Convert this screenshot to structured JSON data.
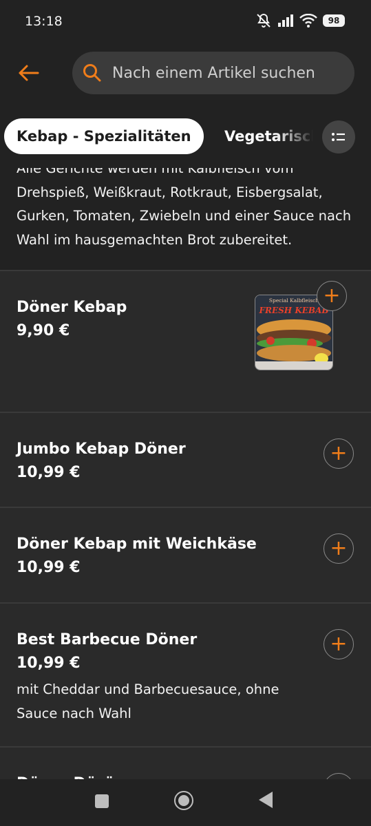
{
  "status_bar": {
    "time": "13:18",
    "battery": "98"
  },
  "search": {
    "placeholder": "Nach einem Artikel suchen"
  },
  "tabs": [
    {
      "label": "Kebap - Spezialitäten",
      "active": true
    },
    {
      "label": "Vegetarisch",
      "active": false
    }
  ],
  "category_description": "Alle Gerichte werden mit Kalbfleisch vom Drehspieß, Weißkraut, Rotkraut, Eisbergsalat, Gurken, Tomaten, Zwiebeln und einer Sauce nach Wahl im hausgemachten Brot zubereitet.",
  "items": [
    {
      "name": "Döner Kebap",
      "price": "9,90 €",
      "image_caption_1": "Special Kalbfleisch",
      "image_caption_2": "FRESH KEBAB"
    },
    {
      "name": "Jumbo Kebap Döner",
      "price": "10,99 €"
    },
    {
      "name": "Döner Kebap mit Weichkäse",
      "price": "10,99 €"
    },
    {
      "name": "Best Barbecue Döner",
      "price": "10,99 €",
      "note": "mit Cheddar und Barbecuesauce, ohne Sauce nach Wahl"
    },
    {
      "name": "Döner Dürüm",
      "price": ""
    }
  ],
  "add_label": "+",
  "colors": {
    "accent": "#f07d1a",
    "background": "#2a2a2a",
    "header": "#222222"
  }
}
